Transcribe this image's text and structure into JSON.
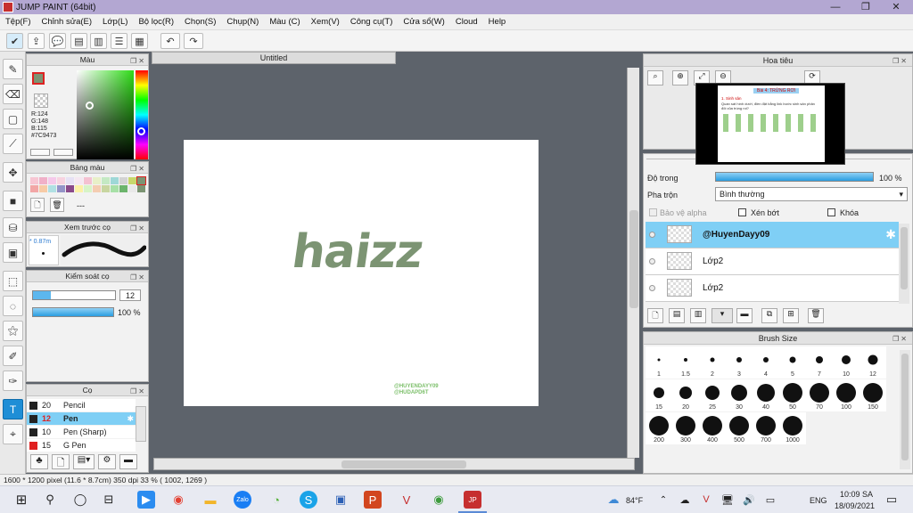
{
  "window": {
    "title": "JUMP PAINT (64bit)",
    "min": "—",
    "max": "❐",
    "close": "✕"
  },
  "menu": [
    "Tệp(F)",
    "Chỉnh sửa(E)",
    "Lớp(L)",
    "Bộ lọc(R)",
    "Chọn(S)",
    "Chụp(N)",
    "Màu (C)",
    "Xem(V)",
    "Công cụ(T)",
    "Cửa sổ(W)",
    "Cloud",
    "Help"
  ],
  "panels": {
    "color": {
      "title": "Màu",
      "r": "R:124",
      "g": "G:148",
      "b": "B:115",
      "hex": "#7C9473",
      "main_color": "#7c9473"
    },
    "palette": {
      "title": "Bảng màu",
      "more": "---"
    },
    "brush_preview": {
      "title": "Xem trước cọ",
      "size": "* 0.87m"
    },
    "brush_control": {
      "title": "Kiểm soát cọ",
      "size_value": "12",
      "opacity_value": "100 %"
    },
    "brush": {
      "title": "Cọ",
      "items": [
        {
          "size": "20",
          "name": "Pencil",
          "color": "#222222"
        },
        {
          "size": "12",
          "name": "Pen",
          "color": "#222222",
          "selected": true
        },
        {
          "size": "10",
          "name": "Pen (Sharp)",
          "color": "#222222"
        },
        {
          "size": "15",
          "name": "G Pen",
          "color": "#e02020"
        }
      ]
    }
  },
  "document": {
    "tab": "Untitled",
    "canvas_text": "haizz",
    "watermark_line1": "@HUYENDAYY09",
    "watermark_line2": "@HUDAPD6T"
  },
  "navigator": {
    "title": "Hoa tiêu",
    "preview_title": "Bài 4: TRỪNG RƠI",
    "preview_heading": "1. Sinh sản",
    "preview_text": "Quan sát hình dưới, điền đặt bằng link bước sinh sản phân đôi của trùng roi?"
  },
  "layers": {
    "opacity_label": "Độ trong",
    "opacity_value": "100 %",
    "blend_label": "Pha trộn",
    "blend_value": "Bình thường",
    "protect_alpha": "Bảo vệ alpha",
    "clip": "Xén bớt",
    "lock": "Khóa",
    "items": [
      {
        "name": "@HuyenDayy09",
        "selected": true
      },
      {
        "name": "Lớp2",
        "selected": false
      },
      {
        "name": "Lớp2",
        "selected": false
      }
    ]
  },
  "brush_size": {
    "title": "Brush Size",
    "sizes": [
      "1",
      "1.5",
      "2",
      "3",
      "4",
      "5",
      "7",
      "10",
      "12",
      "15",
      "20",
      "25",
      "30",
      "40",
      "50",
      "70",
      "100",
      "150",
      "200",
      "300",
      "400",
      "500",
      "700",
      "1000"
    ]
  },
  "status": {
    "text": "1600 * 1200 pixel   (11.6 * 8.7cm)   350 dpi   33 %   ( 1002, 1269 )"
  },
  "taskbar": {
    "weather": "84°F",
    "lang": "ENG",
    "time": "10:09 SA",
    "date": "18/09/2021"
  }
}
